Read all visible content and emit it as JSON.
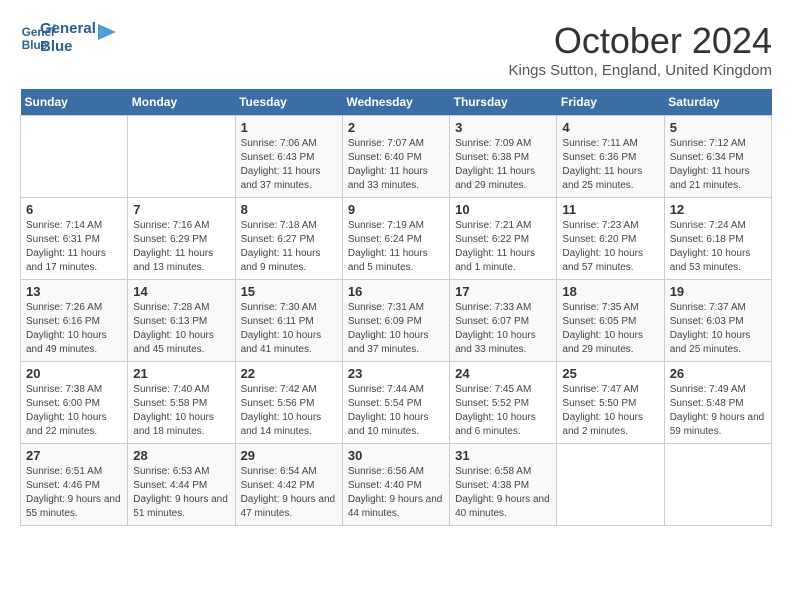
{
  "header": {
    "logo_line1": "General",
    "logo_line2": "Blue",
    "month_title": "October 2024",
    "location": "Kings Sutton, England, United Kingdom"
  },
  "weekdays": [
    "Sunday",
    "Monday",
    "Tuesday",
    "Wednesday",
    "Thursday",
    "Friday",
    "Saturday"
  ],
  "weeks": [
    [
      {
        "day": "",
        "sunrise": "",
        "sunset": "",
        "daylight": ""
      },
      {
        "day": "",
        "sunrise": "",
        "sunset": "",
        "daylight": ""
      },
      {
        "day": "1",
        "sunrise": "Sunrise: 7:06 AM",
        "sunset": "Sunset: 6:43 PM",
        "daylight": "Daylight: 11 hours and 37 minutes."
      },
      {
        "day": "2",
        "sunrise": "Sunrise: 7:07 AM",
        "sunset": "Sunset: 6:40 PM",
        "daylight": "Daylight: 11 hours and 33 minutes."
      },
      {
        "day": "3",
        "sunrise": "Sunrise: 7:09 AM",
        "sunset": "Sunset: 6:38 PM",
        "daylight": "Daylight: 11 hours and 29 minutes."
      },
      {
        "day": "4",
        "sunrise": "Sunrise: 7:11 AM",
        "sunset": "Sunset: 6:36 PM",
        "daylight": "Daylight: 11 hours and 25 minutes."
      },
      {
        "day": "5",
        "sunrise": "Sunrise: 7:12 AM",
        "sunset": "Sunset: 6:34 PM",
        "daylight": "Daylight: 11 hours and 21 minutes."
      }
    ],
    [
      {
        "day": "6",
        "sunrise": "Sunrise: 7:14 AM",
        "sunset": "Sunset: 6:31 PM",
        "daylight": "Daylight: 11 hours and 17 minutes."
      },
      {
        "day": "7",
        "sunrise": "Sunrise: 7:16 AM",
        "sunset": "Sunset: 6:29 PM",
        "daylight": "Daylight: 11 hours and 13 minutes."
      },
      {
        "day": "8",
        "sunrise": "Sunrise: 7:18 AM",
        "sunset": "Sunset: 6:27 PM",
        "daylight": "Daylight: 11 hours and 9 minutes."
      },
      {
        "day": "9",
        "sunrise": "Sunrise: 7:19 AM",
        "sunset": "Sunset: 6:24 PM",
        "daylight": "Daylight: 11 hours and 5 minutes."
      },
      {
        "day": "10",
        "sunrise": "Sunrise: 7:21 AM",
        "sunset": "Sunset: 6:22 PM",
        "daylight": "Daylight: 11 hours and 1 minute."
      },
      {
        "day": "11",
        "sunrise": "Sunrise: 7:23 AM",
        "sunset": "Sunset: 6:20 PM",
        "daylight": "Daylight: 10 hours and 57 minutes."
      },
      {
        "day": "12",
        "sunrise": "Sunrise: 7:24 AM",
        "sunset": "Sunset: 6:18 PM",
        "daylight": "Daylight: 10 hours and 53 minutes."
      }
    ],
    [
      {
        "day": "13",
        "sunrise": "Sunrise: 7:26 AM",
        "sunset": "Sunset: 6:16 PM",
        "daylight": "Daylight: 10 hours and 49 minutes."
      },
      {
        "day": "14",
        "sunrise": "Sunrise: 7:28 AM",
        "sunset": "Sunset: 6:13 PM",
        "daylight": "Daylight: 10 hours and 45 minutes."
      },
      {
        "day": "15",
        "sunrise": "Sunrise: 7:30 AM",
        "sunset": "Sunset: 6:11 PM",
        "daylight": "Daylight: 10 hours and 41 minutes."
      },
      {
        "day": "16",
        "sunrise": "Sunrise: 7:31 AM",
        "sunset": "Sunset: 6:09 PM",
        "daylight": "Daylight: 10 hours and 37 minutes."
      },
      {
        "day": "17",
        "sunrise": "Sunrise: 7:33 AM",
        "sunset": "Sunset: 6:07 PM",
        "daylight": "Daylight: 10 hours and 33 minutes."
      },
      {
        "day": "18",
        "sunrise": "Sunrise: 7:35 AM",
        "sunset": "Sunset: 6:05 PM",
        "daylight": "Daylight: 10 hours and 29 minutes."
      },
      {
        "day": "19",
        "sunrise": "Sunrise: 7:37 AM",
        "sunset": "Sunset: 6:03 PM",
        "daylight": "Daylight: 10 hours and 25 minutes."
      }
    ],
    [
      {
        "day": "20",
        "sunrise": "Sunrise: 7:38 AM",
        "sunset": "Sunset: 6:00 PM",
        "daylight": "Daylight: 10 hours and 22 minutes."
      },
      {
        "day": "21",
        "sunrise": "Sunrise: 7:40 AM",
        "sunset": "Sunset: 5:58 PM",
        "daylight": "Daylight: 10 hours and 18 minutes."
      },
      {
        "day": "22",
        "sunrise": "Sunrise: 7:42 AM",
        "sunset": "Sunset: 5:56 PM",
        "daylight": "Daylight: 10 hours and 14 minutes."
      },
      {
        "day": "23",
        "sunrise": "Sunrise: 7:44 AM",
        "sunset": "Sunset: 5:54 PM",
        "daylight": "Daylight: 10 hours and 10 minutes."
      },
      {
        "day": "24",
        "sunrise": "Sunrise: 7:45 AM",
        "sunset": "Sunset: 5:52 PM",
        "daylight": "Daylight: 10 hours and 6 minutes."
      },
      {
        "day": "25",
        "sunrise": "Sunrise: 7:47 AM",
        "sunset": "Sunset: 5:50 PM",
        "daylight": "Daylight: 10 hours and 2 minutes."
      },
      {
        "day": "26",
        "sunrise": "Sunrise: 7:49 AM",
        "sunset": "Sunset: 5:48 PM",
        "daylight": "Daylight: 9 hours and 59 minutes."
      }
    ],
    [
      {
        "day": "27",
        "sunrise": "Sunrise: 6:51 AM",
        "sunset": "Sunset: 4:46 PM",
        "daylight": "Daylight: 9 hours and 55 minutes."
      },
      {
        "day": "28",
        "sunrise": "Sunrise: 6:53 AM",
        "sunset": "Sunset: 4:44 PM",
        "daylight": "Daylight: 9 hours and 51 minutes."
      },
      {
        "day": "29",
        "sunrise": "Sunrise: 6:54 AM",
        "sunset": "Sunset: 4:42 PM",
        "daylight": "Daylight: 9 hours and 47 minutes."
      },
      {
        "day": "30",
        "sunrise": "Sunrise: 6:56 AM",
        "sunset": "Sunset: 4:40 PM",
        "daylight": "Daylight: 9 hours and 44 minutes."
      },
      {
        "day": "31",
        "sunrise": "Sunrise: 6:58 AM",
        "sunset": "Sunset: 4:38 PM",
        "daylight": "Daylight: 9 hours and 40 minutes."
      },
      {
        "day": "",
        "sunrise": "",
        "sunset": "",
        "daylight": ""
      },
      {
        "day": "",
        "sunrise": "",
        "sunset": "",
        "daylight": ""
      }
    ]
  ]
}
